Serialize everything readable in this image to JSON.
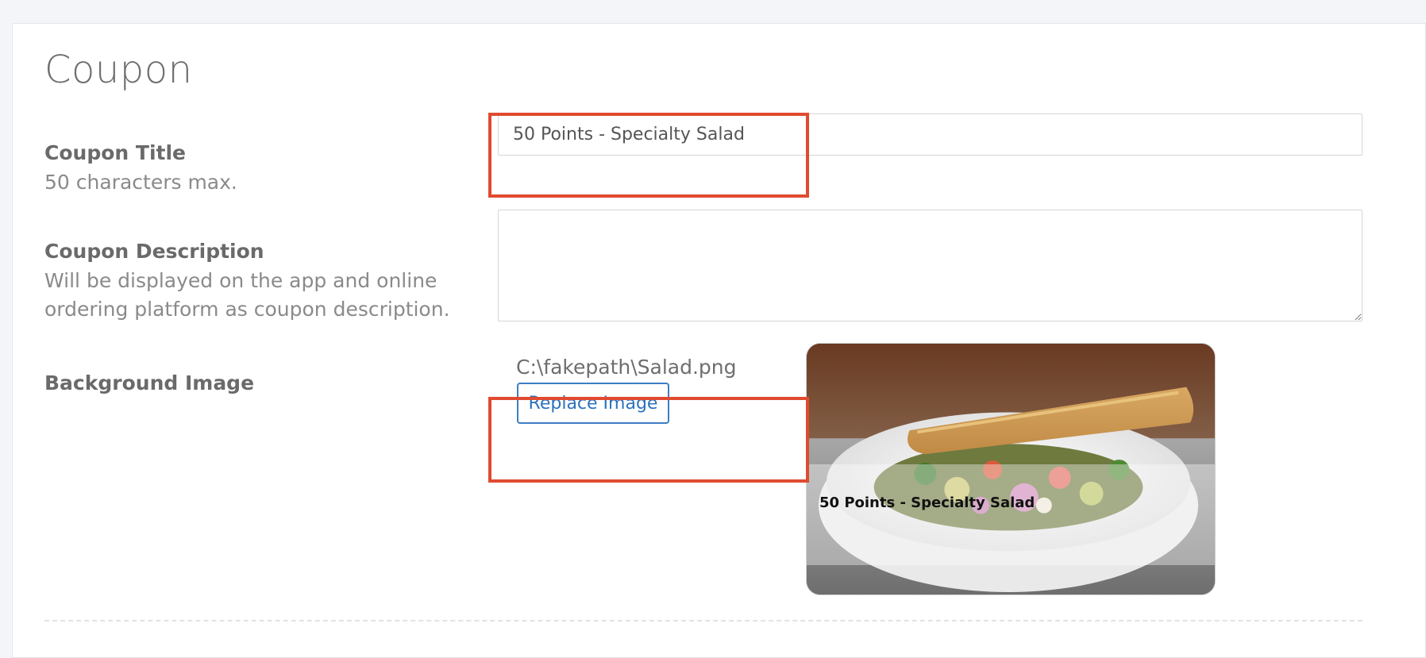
{
  "section": {
    "title": "Coupon"
  },
  "coupon_title": {
    "label": "Coupon Title",
    "help": "50 characters max.",
    "value": "50 Points - Specialty Salad"
  },
  "coupon_description": {
    "label": "Coupon Description",
    "help": "Will be displayed on the app and online ordering platform as coupon description.",
    "value": ""
  },
  "background_image": {
    "label": "Background Image",
    "file_path": "C:\\fakepath\\Salad.png",
    "replace_label": "Replace Image",
    "preview_caption": "50 Points - Specialty Salad"
  },
  "colors": {
    "highlight": "#e04a2f",
    "link_blue": "#2c72bd"
  },
  "icons": {
    "textarea_resize": "resize-grip-icon"
  }
}
